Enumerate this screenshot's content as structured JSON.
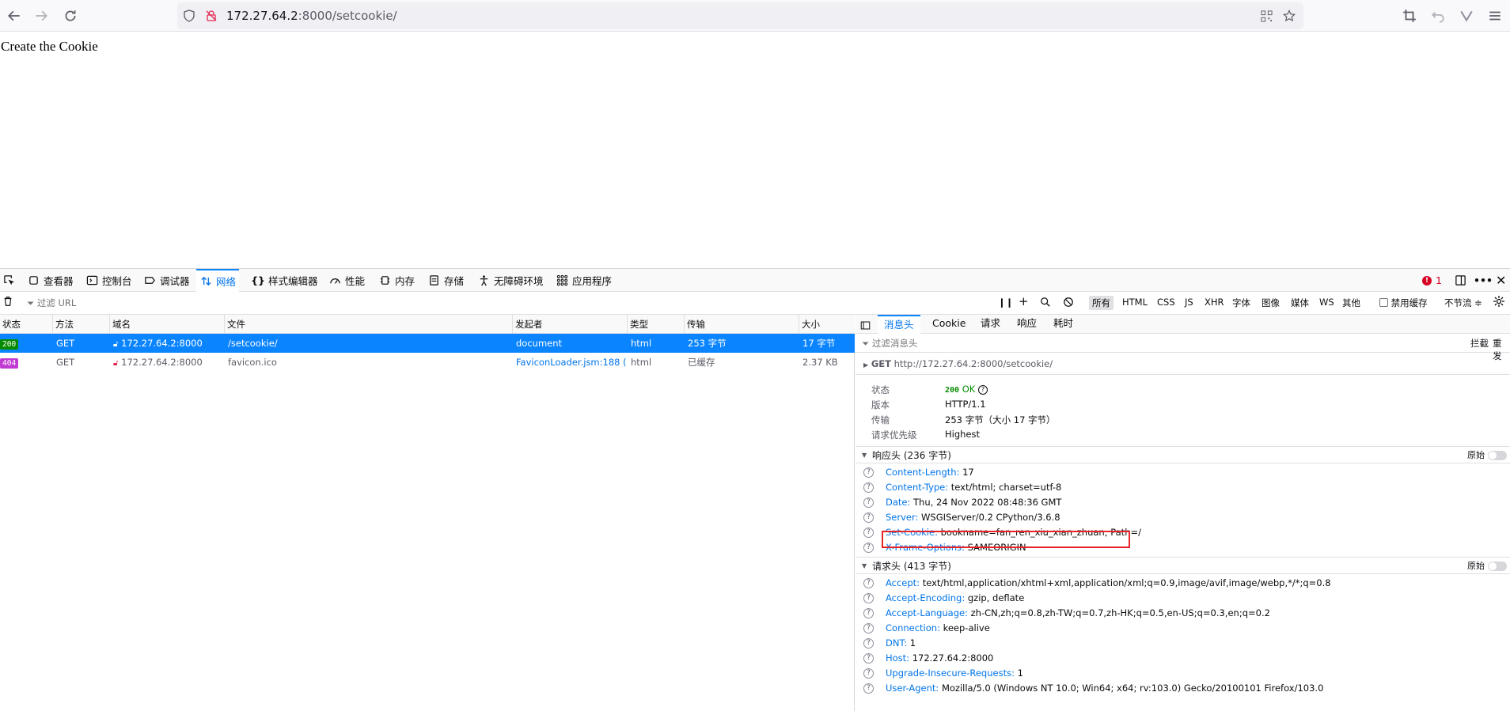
{
  "browser": {
    "url_host": "172.27.64.2",
    "url_path": ":8000/setcookie/"
  },
  "page": {
    "heading": "Create the Cookie"
  },
  "devtools": {
    "tabs": [
      {
        "label": "查看器",
        "icon": "inspector-icon"
      },
      {
        "label": "控制台",
        "icon": "console-icon"
      },
      {
        "label": "调试器",
        "icon": "debugger-icon"
      },
      {
        "label": "网络",
        "icon": "network-icon"
      },
      {
        "label": "样式编辑器",
        "icon": "style-editor-icon"
      },
      {
        "label": "性能",
        "icon": "performance-icon"
      },
      {
        "label": "内存",
        "icon": "memory-icon"
      },
      {
        "label": "存储",
        "icon": "storage-icon"
      },
      {
        "label": "无障碍环境",
        "icon": "accessibility-icon"
      },
      {
        "label": "应用程序",
        "icon": "application-icon"
      }
    ],
    "error_count": "1",
    "filter_placeholder": "过滤 URL",
    "type_filters": [
      "所有",
      "HTML",
      "CSS",
      "JS",
      "XHR",
      "字体",
      "图像",
      "媒体",
      "WS",
      "其他"
    ],
    "disable_cache_label": "禁用缓存",
    "throttle_label": "不节流 ≑",
    "columns": [
      "状态",
      "方法",
      "域名",
      "文件",
      "发起者",
      "类型",
      "传输",
      "大小"
    ],
    "requests": [
      {
        "status": "200",
        "method": "GET",
        "domain": "172.27.64.2:8000",
        "file": "/setcookie/",
        "initiator": "document",
        "type": "html",
        "transfer": "253 字节",
        "size": "17 字节"
      },
      {
        "status": "404",
        "method": "GET",
        "domain": "172.27.64.2:8000",
        "file": "favicon.ico",
        "initiator": "FaviconLoader.jsm:188 (…",
        "type": "html",
        "transfer": "已缓存",
        "size": "2.37 KB"
      }
    ],
    "side_panel": {
      "tabs": [
        "消息头",
        "Cookie",
        "请求",
        "响应",
        "耗时"
      ],
      "filter_placeholder": "过滤消息头",
      "block_label": "拦截",
      "resend_label": "重发",
      "request_line": {
        "method": "GET",
        "url": "http://172.27.64.2:8000/setcookie/"
      },
      "summary": [
        {
          "key": "状态",
          "value_code": "200",
          "value_text": "OK"
        },
        {
          "key": "版本",
          "value": "HTTP/1.1"
        },
        {
          "key": "传输",
          "value": "253 字节（大小 17 字节）"
        },
        {
          "key": "请求优先级",
          "value": "Highest"
        }
      ],
      "response_headers_title": "响应头 (236 字节)",
      "raw_label": "原始",
      "response_headers": [
        {
          "key": "Content-Length:",
          "value": "17"
        },
        {
          "key": "Content-Type:",
          "value": "text/html; charset=utf-8"
        },
        {
          "key": "Date:",
          "value": "Thu, 24 Nov 2022 08:48:36 GMT"
        },
        {
          "key": "Server:",
          "value": "WSGIServer/0.2 CPython/3.6.8"
        },
        {
          "key": "Set-Cookie:",
          "value": "bookname=fan_ren_xiu_xian_zhuan; Path=/"
        },
        {
          "key": "X-Frame-Options:",
          "value": "SAMEORIGIN"
        }
      ],
      "request_headers_title": "请求头 (413 字节)",
      "request_headers": [
        {
          "key": "Accept:",
          "value": "text/html,application/xhtml+xml,application/xml;q=0.9,image/avif,image/webp,*/*;q=0.8"
        },
        {
          "key": "Accept-Encoding:",
          "value": "gzip, deflate"
        },
        {
          "key": "Accept-Language:",
          "value": "zh-CN,zh;q=0.8,zh-TW;q=0.7,zh-HK;q=0.5,en-US;q=0.3,en;q=0.2"
        },
        {
          "key": "Connection:",
          "value": "keep-alive"
        },
        {
          "key": "DNT:",
          "value": "1"
        },
        {
          "key": "Host:",
          "value": "172.27.64.2:8000"
        },
        {
          "key": "Upgrade-Insecure-Requests:",
          "value": "1"
        },
        {
          "key": "User-Agent:",
          "value": "Mozilla/5.0 (Windows NT 10.0; Win64; x64; rv:103.0) Gecko/20100101 Firefox/103.0"
        }
      ]
    }
  },
  "colors": {
    "accent": "#0a84ff",
    "status_ok": "#058b00",
    "status_404": "#c13ad2",
    "highlight": "#e5252a"
  }
}
